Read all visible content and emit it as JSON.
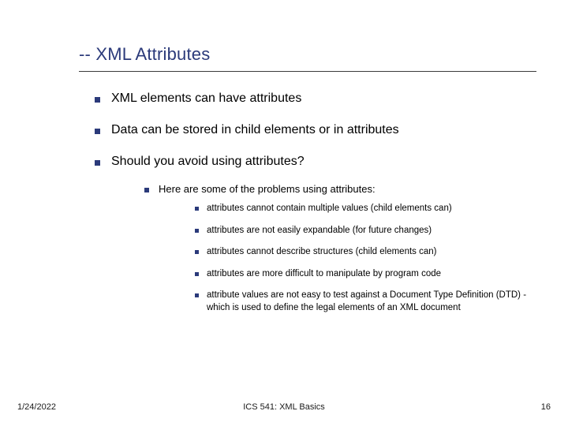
{
  "title": "-- XML Attributes",
  "bullets": {
    "b1": "XML elements can have attributes",
    "b2": "Data can be stored in child elements or in attributes",
    "b3": "Should you avoid using attributes?",
    "sub1": "Here are some of the problems using attributes:",
    "p1": "attributes cannot contain multiple values (child elements can)",
    "p2": "attributes are not easily expandable (for future changes)",
    "p3": "attributes cannot describe structures (child elements can)",
    "p4": "attributes are more difficult to manipulate by program code",
    "p5": "attribute values are not easy to test against a Document Type Definition (DTD) - which is used to define the legal elements of an XML document"
  },
  "footer": {
    "date": "1/24/2022",
    "center": "ICS 541: XML Basics",
    "page": "16"
  }
}
